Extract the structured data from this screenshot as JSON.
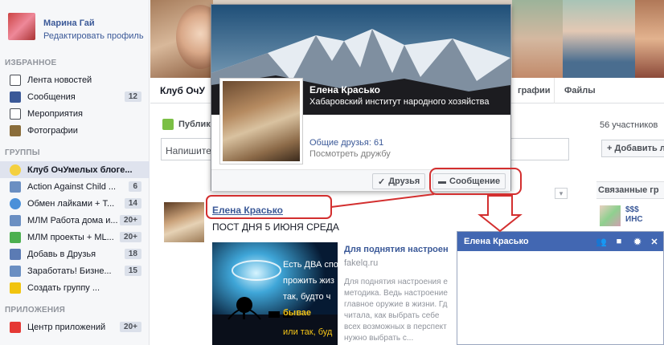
{
  "profile": {
    "name": "Марина Гай",
    "edit_label": "Редактировать профиль"
  },
  "sections": {
    "favorites": "ИЗБРАННОЕ",
    "groups": "ГРУППЫ",
    "apps": "ПРИЛОЖЕНИЯ"
  },
  "favorites": [
    {
      "label": "Лента новостей",
      "badge": "",
      "icon": "news-feed-icon"
    },
    {
      "label": "Сообщения",
      "badge": "12",
      "icon": "messages-icon"
    },
    {
      "label": "Мероприятия",
      "badge": "",
      "icon": "events-icon"
    },
    {
      "label": "Фотографии",
      "badge": "",
      "icon": "photos-icon"
    }
  ],
  "groups": [
    {
      "label": "Клуб ОчУмелых блоге...",
      "badge": "",
      "icon": "lightbulb-icon"
    },
    {
      "label": "Action Against Child ...",
      "badge": "6",
      "icon": "group-icon"
    },
    {
      "label": "Обмен лайками + Т...",
      "badge": "14",
      "icon": "globe-icon"
    },
    {
      "label": "МЛМ Работа дома и...",
      "badge": "20+",
      "icon": "group-icon"
    },
    {
      "label": "МЛМ проекты + МL...",
      "badge": "20+",
      "icon": "mountain-icon"
    },
    {
      "label": "Добавь в Друзья",
      "badge": "18",
      "icon": "person-icon"
    },
    {
      "label": "Заработать! Бизне...",
      "badge": "15",
      "icon": "group-icon"
    },
    {
      "label": "Создать группу ...",
      "badge": "",
      "icon": "create-group-icon"
    }
  ],
  "apps": [
    {
      "label": "Центр приложений",
      "badge": "20+",
      "icon": "app-center-icon"
    }
  ],
  "tabs": {
    "group_name": "Клуб ОчУ",
    "photos": "графии",
    "files": "Файлы"
  },
  "composer": {
    "tab_label": "Публик",
    "placeholder": "Напишите"
  },
  "popup": {
    "name": "Елена Красько",
    "subtitle": "Хабаровский институт народного хозяйства",
    "mutual_friends": "Общие друзья: 61",
    "see_friendship": "Посмотреть дружбу",
    "friends_button": "Друзья",
    "message_button": "Сообщение"
  },
  "post": {
    "author": "Елена Красько",
    "text": "ПОСТ ДНЯ 5 ИЮНЯ СРЕДА",
    "link_title": "Для поднятия настроен",
    "link_domain": "fakelq.ru",
    "link_desc": "Для поднятия настроения е методика. Ведь настроение главное оружие в жизни. Гд читала, как выбрать себе всех возможных в перспект нужно выбрать с...",
    "image_text_1": "Есть ДВА спо",
    "image_text_2": "прожить жиз",
    "image_text_3": "так, будто ч",
    "image_text_4": "бывае",
    "image_text_5": "или так, буд"
  },
  "right": {
    "members": "56 участников",
    "add_label": "+ Добавить л",
    "related": "Связанные гр",
    "promo": "$$$ ИНС"
  },
  "chat": {
    "name": "Елена Красько"
  },
  "colors": {
    "brand": "#3b5998",
    "chat_header": "#4267b2",
    "annotation": "#d32f2f"
  }
}
